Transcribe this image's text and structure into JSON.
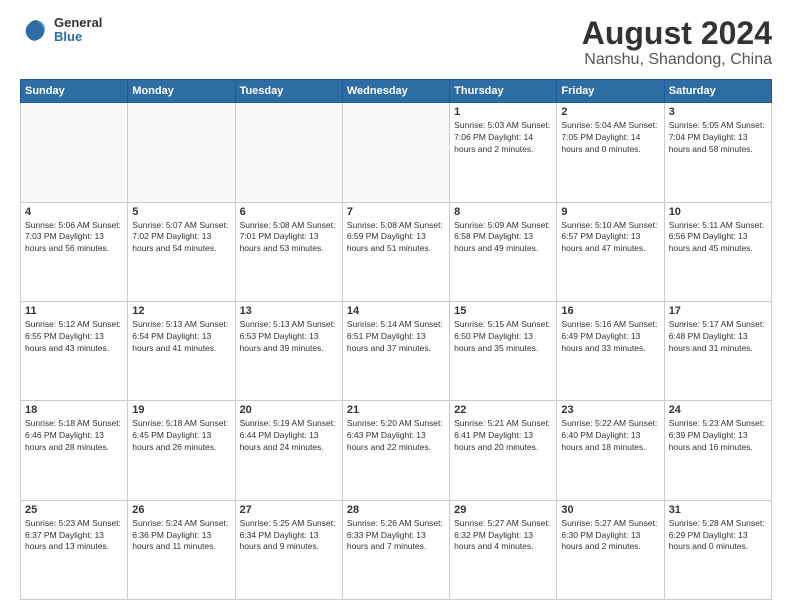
{
  "logo": {
    "general": "General",
    "blue": "Blue"
  },
  "title": "August 2024",
  "subtitle": "Nanshu, Shandong, China",
  "days_of_week": [
    "Sunday",
    "Monday",
    "Tuesday",
    "Wednesday",
    "Thursday",
    "Friday",
    "Saturday"
  ],
  "weeks": [
    [
      {
        "day": "",
        "info": "",
        "empty": true
      },
      {
        "day": "",
        "info": "",
        "empty": true
      },
      {
        "day": "",
        "info": "",
        "empty": true
      },
      {
        "day": "",
        "info": "",
        "empty": true
      },
      {
        "day": "1",
        "info": "Sunrise: 5:03 AM\nSunset: 7:06 PM\nDaylight: 14 hours\nand 2 minutes."
      },
      {
        "day": "2",
        "info": "Sunrise: 5:04 AM\nSunset: 7:05 PM\nDaylight: 14 hours\nand 0 minutes."
      },
      {
        "day": "3",
        "info": "Sunrise: 5:05 AM\nSunset: 7:04 PM\nDaylight: 13 hours\nand 58 minutes."
      }
    ],
    [
      {
        "day": "4",
        "info": "Sunrise: 5:06 AM\nSunset: 7:03 PM\nDaylight: 13 hours\nand 56 minutes."
      },
      {
        "day": "5",
        "info": "Sunrise: 5:07 AM\nSunset: 7:02 PM\nDaylight: 13 hours\nand 54 minutes."
      },
      {
        "day": "6",
        "info": "Sunrise: 5:08 AM\nSunset: 7:01 PM\nDaylight: 13 hours\nand 53 minutes."
      },
      {
        "day": "7",
        "info": "Sunrise: 5:08 AM\nSunset: 6:59 PM\nDaylight: 13 hours\nand 51 minutes."
      },
      {
        "day": "8",
        "info": "Sunrise: 5:09 AM\nSunset: 6:58 PM\nDaylight: 13 hours\nand 49 minutes."
      },
      {
        "day": "9",
        "info": "Sunrise: 5:10 AM\nSunset: 6:57 PM\nDaylight: 13 hours\nand 47 minutes."
      },
      {
        "day": "10",
        "info": "Sunrise: 5:11 AM\nSunset: 6:56 PM\nDaylight: 13 hours\nand 45 minutes."
      }
    ],
    [
      {
        "day": "11",
        "info": "Sunrise: 5:12 AM\nSunset: 6:55 PM\nDaylight: 13 hours\nand 43 minutes."
      },
      {
        "day": "12",
        "info": "Sunrise: 5:13 AM\nSunset: 6:54 PM\nDaylight: 13 hours\nand 41 minutes."
      },
      {
        "day": "13",
        "info": "Sunrise: 5:13 AM\nSunset: 6:53 PM\nDaylight: 13 hours\nand 39 minutes."
      },
      {
        "day": "14",
        "info": "Sunrise: 5:14 AM\nSunset: 6:51 PM\nDaylight: 13 hours\nand 37 minutes."
      },
      {
        "day": "15",
        "info": "Sunrise: 5:15 AM\nSunset: 6:50 PM\nDaylight: 13 hours\nand 35 minutes."
      },
      {
        "day": "16",
        "info": "Sunrise: 5:16 AM\nSunset: 6:49 PM\nDaylight: 13 hours\nand 33 minutes."
      },
      {
        "day": "17",
        "info": "Sunrise: 5:17 AM\nSunset: 6:48 PM\nDaylight: 13 hours\nand 31 minutes."
      }
    ],
    [
      {
        "day": "18",
        "info": "Sunrise: 5:18 AM\nSunset: 6:46 PM\nDaylight: 13 hours\nand 28 minutes."
      },
      {
        "day": "19",
        "info": "Sunrise: 5:18 AM\nSunset: 6:45 PM\nDaylight: 13 hours\nand 26 minutes."
      },
      {
        "day": "20",
        "info": "Sunrise: 5:19 AM\nSunset: 6:44 PM\nDaylight: 13 hours\nand 24 minutes."
      },
      {
        "day": "21",
        "info": "Sunrise: 5:20 AM\nSunset: 6:43 PM\nDaylight: 13 hours\nand 22 minutes."
      },
      {
        "day": "22",
        "info": "Sunrise: 5:21 AM\nSunset: 6:41 PM\nDaylight: 13 hours\nand 20 minutes."
      },
      {
        "day": "23",
        "info": "Sunrise: 5:22 AM\nSunset: 6:40 PM\nDaylight: 13 hours\nand 18 minutes."
      },
      {
        "day": "24",
        "info": "Sunrise: 5:23 AM\nSunset: 6:39 PM\nDaylight: 13 hours\nand 16 minutes."
      }
    ],
    [
      {
        "day": "25",
        "info": "Sunrise: 5:23 AM\nSunset: 6:37 PM\nDaylight: 13 hours\nand 13 minutes."
      },
      {
        "day": "26",
        "info": "Sunrise: 5:24 AM\nSunset: 6:36 PM\nDaylight: 13 hours\nand 11 minutes."
      },
      {
        "day": "27",
        "info": "Sunrise: 5:25 AM\nSunset: 6:34 PM\nDaylight: 13 hours\nand 9 minutes."
      },
      {
        "day": "28",
        "info": "Sunrise: 5:26 AM\nSunset: 6:33 PM\nDaylight: 13 hours\nand 7 minutes."
      },
      {
        "day": "29",
        "info": "Sunrise: 5:27 AM\nSunset: 6:32 PM\nDaylight: 13 hours\nand 4 minutes."
      },
      {
        "day": "30",
        "info": "Sunrise: 5:27 AM\nSunset: 6:30 PM\nDaylight: 13 hours\nand 2 minutes."
      },
      {
        "day": "31",
        "info": "Sunrise: 5:28 AM\nSunset: 6:29 PM\nDaylight: 13 hours\nand 0 minutes."
      }
    ]
  ]
}
